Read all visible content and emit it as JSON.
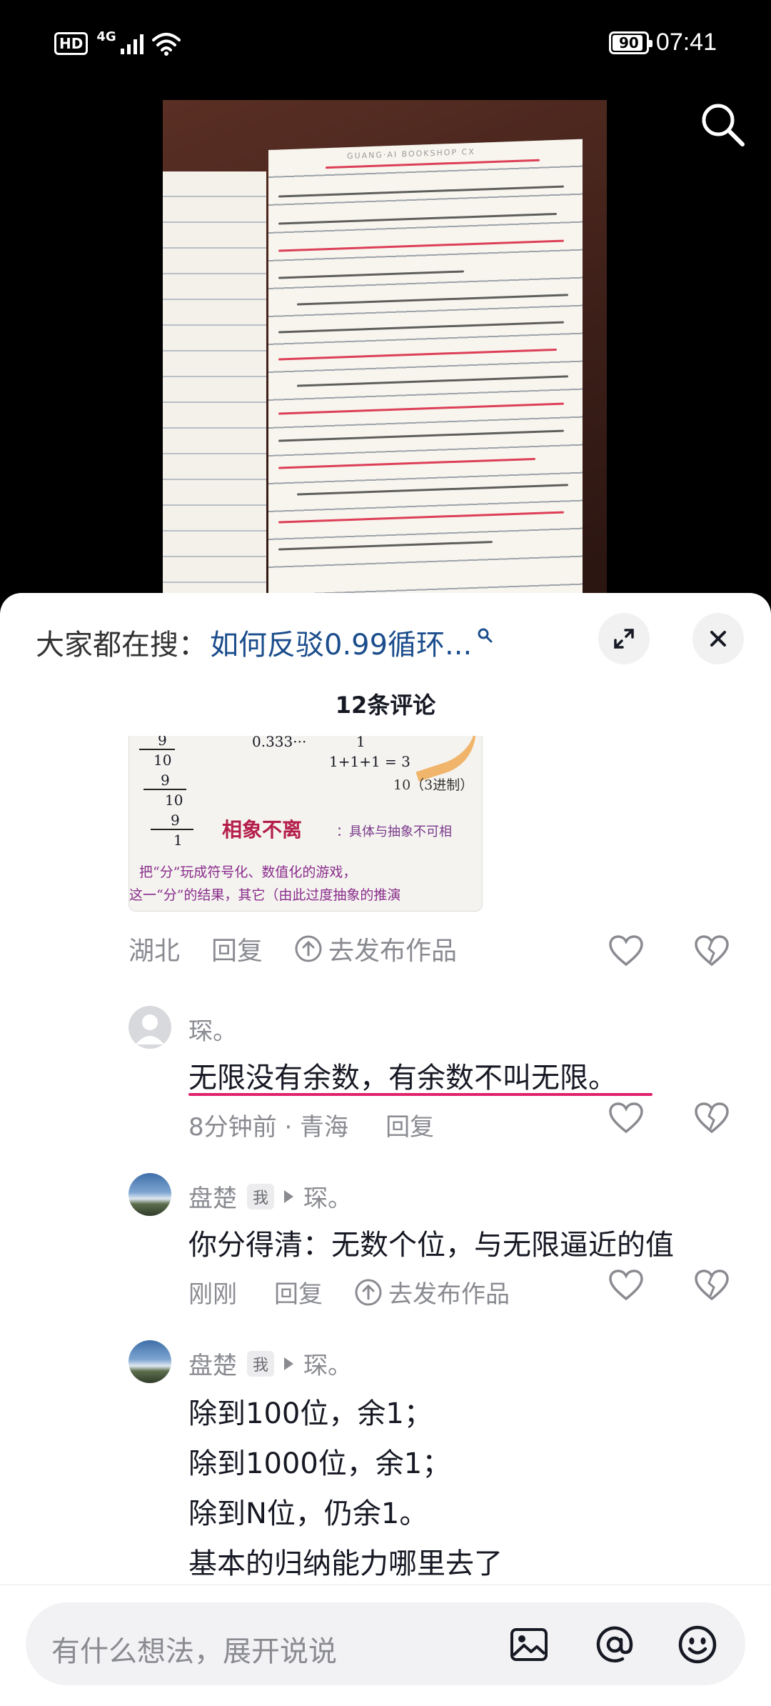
{
  "status_bar": {
    "hd": "HD",
    "network": "4G",
    "battery": "90",
    "time": "07:41"
  },
  "photo": {
    "book_brand": "GUANG·AI BOOKSHOP CX"
  },
  "sheet": {
    "hot_search_label": "大家都在搜：",
    "hot_search_query": "如何反驳0.99循环...",
    "comment_count": "12条评论"
  },
  "image_card": {
    "n1": "9",
    "n2": "10",
    "n3": "9",
    "n4": "10",
    "n5": "9",
    "n6": "1",
    "val": "0.333···",
    "one": "1",
    "sum": "1+1+1 = 3",
    "base3": "10（3进制）",
    "heading": "相象不离",
    "sub": "：具体与抽象不可相",
    "line1": "把“分”玩成符号化、数值化的游戏，",
    "line2": "这一“分”的结果，其它（由此过度抽象的推演"
  },
  "comments": [
    {
      "location": "湖北",
      "reply": "回复",
      "publish": "去发布作品"
    },
    {
      "user": "琛。",
      "text": "无限没有余数，有余数不叫无限。",
      "time": "8分钟前 · 青海",
      "reply": "回复"
    },
    {
      "user": "盘楚",
      "badge": "我",
      "reply_to": "琛。",
      "text": "你分得清：无数个位，与无限逼近的值",
      "time": "刚刚",
      "reply": "回复",
      "publish": "去发布作品"
    },
    {
      "user": "盘楚",
      "badge": "我",
      "reply_to": "琛。",
      "lines": [
        "除到100位，余1；",
        "除到1000位，余1；",
        "除到N位，仍余1。",
        "基本的归纳能力哪里去了"
      ]
    }
  ],
  "input": {
    "placeholder": "有什么想法，展开说说"
  }
}
